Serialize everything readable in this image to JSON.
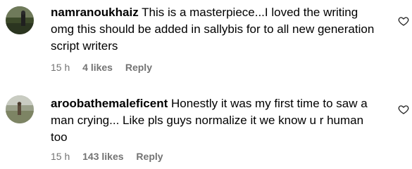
{
  "comments": [
    {
      "username": "namranoukhaiz",
      "text": "This is a masterpiece...I loved the writing omg this should be added in sallybis for to all new generation script writers",
      "time": "15 h",
      "likes": "4 likes",
      "reply_label": "Reply",
      "like_icon": "heart-outline-icon"
    },
    {
      "username": "aroobathemaleficent",
      "text": "Honestly it was my first time to saw a man crying... Like pls guys normalize it we know u r human too",
      "time": "15 h",
      "likes": "143 likes",
      "reply_label": "Reply",
      "like_icon": "heart-outline-icon"
    }
  ],
  "colors": {
    "text": "#000000",
    "meta": "#737373",
    "background": "#ffffff"
  }
}
